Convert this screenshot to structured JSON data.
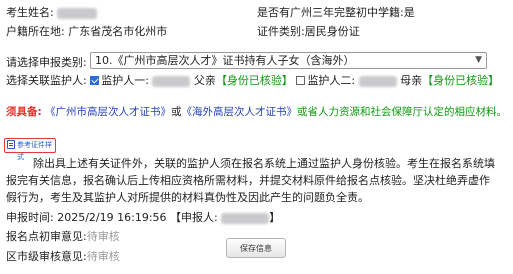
{
  "info": {
    "name_label": "考生姓名:",
    "school_question": "是否有广州三年完整初中学籍:",
    "school_answer": "是",
    "hukou_label": "户籍所在地:",
    "hukou_value": "广东省茂名市化州市",
    "cert_type_label": "证件类别:",
    "cert_type_value": "居民身份证"
  },
  "category": {
    "label": "请选择申报类别:",
    "selected": "10.《广州市高层次人才》证书持有人子女（含海外）"
  },
  "guardian": {
    "label": "选择关联监护人:",
    "guardian1_label": "监护人一:",
    "guardian1_checked": true,
    "guardian1_relation": "父亲",
    "guardian1_status": "【身份已核验】",
    "guardian2_label": "监护人二:",
    "guardian2_checked": false,
    "guardian2_relation": "母亲",
    "guardian2_status": "【身份已核验】"
  },
  "required": {
    "label": "须具备:",
    "text1": "《广州市高层次人才证书》",
    "or1": "或",
    "text2": "《海外高层次人才证书》",
    "text3": "或省人力资源和社会保障厅认定的相应材料。"
  },
  "ref_button": {
    "label": "参考证件样式"
  },
  "notice": "除出具上述有关证件外，关联的监护人须在报名系统上通过监护人身份核验。考生在报名系统填报完有关信息，报名确认后上传相应资格所需材料，并提交材料原件给报名点核验。坚决杜绝弄虚作假行为，考生及其监护人对所提供的材料真伪性及因此产生的问题负全责。",
  "submit": {
    "time_label": "申报时间:",
    "time_value": "2025/2/19 16:19:56",
    "reporter_label": "【申报人:",
    "reporter_close": "】"
  },
  "review": {
    "point_label": "报名点初审意见:",
    "point_value": "待审核",
    "district_label": "区市级审核意见:",
    "district_value": "待审核"
  },
  "actions": {
    "save_label": "保存信息"
  },
  "colors": {
    "green": "#119911",
    "red": "#e8312b",
    "blue": "#233fbe",
    "gray": "#9a9a9a"
  }
}
